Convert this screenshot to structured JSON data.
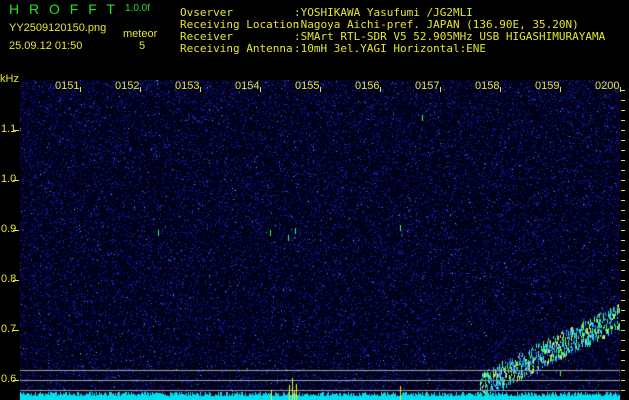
{
  "header": {
    "app_title": "H R O F F T",
    "version": "1.0.0f",
    "filename": "YY2509120150.png",
    "datetime": "25.09.12 01:50",
    "meteor_label": "meteor",
    "meteor_count": "5"
  },
  "info": [
    {
      "label": "Ovserver",
      "value": ":YOSHIKAWA Yasufumi /JG2MLI"
    },
    {
      "label": "Receiving Location",
      "value": ":Nagoya Aichi-pref. JAPAN (136.90E, 35.20N)"
    },
    {
      "label": "Receiver",
      "value": ":SMArt RTL-SDR V5 52.905MHz USB HIGASHIMURAYAMA"
    },
    {
      "label": "Receiving Antenna",
      "value": ":10mH 3el.YAGI Horizontal:ENE"
    }
  ],
  "axis": {
    "unit": "kHz",
    "time_labels": [
      "0151",
      "0152",
      "0153",
      "0154",
      "0155",
      "0156",
      "0157",
      "0158",
      "0159",
      "0200"
    ],
    "freq_labels": [
      "1.1",
      "1.0",
      "0.9",
      "0.8",
      "0.7",
      "0.6"
    ]
  },
  "colors": {
    "text_green": "#22e022",
    "text_yellow": "#e6e630",
    "background": "#000014",
    "noise": "#1a1ad0",
    "floor": "#00e0f0"
  }
}
